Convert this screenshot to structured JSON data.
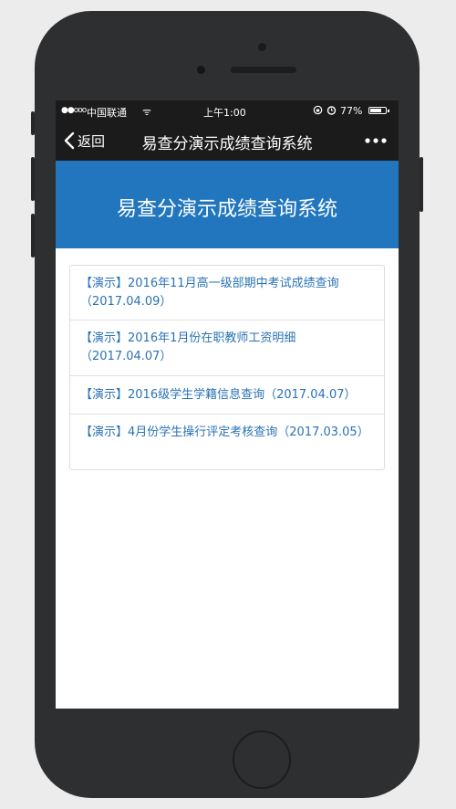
{
  "status_bar": {
    "signal": "●●ooo",
    "carrier": "中国联通",
    "wifi": "ᯤ",
    "time": "上午1:00",
    "lock_icon": "rotation-lock-icon",
    "alarm_icon": "alarm-icon",
    "battery_percent": "77%",
    "battery_level": 0.77
  },
  "nav": {
    "back_label": "返回",
    "title": "易查分演示成绩查询系统",
    "more_icon": "more-dots-icon"
  },
  "banner": {
    "title": "易查分演示成绩查询系统",
    "background": "#2176be"
  },
  "list": {
    "items": [
      {
        "title": "【演示】2016年11月高一级部期中考试成绩查询（2017.04.09）"
      },
      {
        "title": "【演示】2016年1月份在职教师工资明细（2017.04.07）"
      },
      {
        "title": "【演示】2016级学生学籍信息查询（2017.04.07）"
      },
      {
        "title": "【演示】4月份学生操行评定考核查询（2017.03.05）"
      }
    ],
    "link_color": "#2a72b5"
  }
}
